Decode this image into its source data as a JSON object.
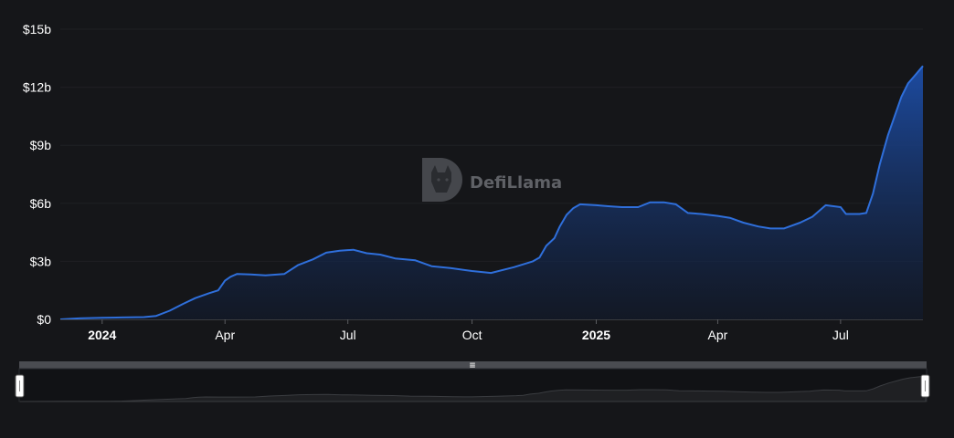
{
  "chart_data": {
    "type": "area",
    "title": "",
    "xlabel": "",
    "ylabel": "",
    "ylim": [
      0,
      15000000000
    ],
    "y_ticks": [
      {
        "value": 0,
        "label": "$0"
      },
      {
        "value": 3000000000,
        "label": "$3b"
      },
      {
        "value": 6000000000,
        "label": "$6b"
      },
      {
        "value": 9000000000,
        "label": "$9b"
      },
      {
        "value": 12000000000,
        "label": "$12b"
      },
      {
        "value": 15000000000,
        "label": "$15b"
      }
    ],
    "x_range": [
      "2023-12-01",
      "2025-08-31"
    ],
    "x_ticks": [
      {
        "date": "2024-01-01",
        "label": "2024",
        "strong": true
      },
      {
        "date": "2024-04-01",
        "label": "Apr",
        "strong": false
      },
      {
        "date": "2024-07-01",
        "label": "Jul",
        "strong": false
      },
      {
        "date": "2024-10-01",
        "label": "Oct",
        "strong": false
      },
      {
        "date": "2025-01-01",
        "label": "2025",
        "strong": true
      },
      {
        "date": "2025-04-01",
        "label": "Apr",
        "strong": false
      },
      {
        "date": "2025-07-01",
        "label": "Jul",
        "strong": false
      }
    ],
    "grid": true,
    "line_color": "#2f6fdb",
    "fill_color_top": "#1d4ea8",
    "fill_color_bottom": "#111a2d",
    "series": [
      {
        "x": [
          "2023-12-01",
          "2023-12-15",
          "2024-01-01",
          "2024-01-15",
          "2024-02-01",
          "2024-02-10",
          "2024-02-20",
          "2024-03-01",
          "2024-03-10",
          "2024-03-20",
          "2024-03-27",
          "2024-04-01",
          "2024-04-05",
          "2024-04-10",
          "2024-04-20",
          "2024-05-01",
          "2024-05-15",
          "2024-05-25",
          "2024-06-05",
          "2024-06-15",
          "2024-06-25",
          "2024-07-05",
          "2024-07-15",
          "2024-07-25",
          "2024-08-05",
          "2024-08-20",
          "2024-09-01",
          "2024-09-15",
          "2024-10-01",
          "2024-10-15",
          "2024-11-01",
          "2024-11-15",
          "2024-11-20",
          "2024-11-25",
          "2024-12-01",
          "2024-12-05",
          "2024-12-10",
          "2024-12-15",
          "2024-12-20",
          "2025-01-01",
          "2025-01-10",
          "2025-01-20",
          "2025-02-01",
          "2025-02-10",
          "2025-02-20",
          "2025-03-01",
          "2025-03-10",
          "2025-03-20",
          "2025-04-01",
          "2025-04-10",
          "2025-04-20",
          "2025-05-01",
          "2025-05-10",
          "2025-05-20",
          "2025-06-01",
          "2025-06-10",
          "2025-06-20",
          "2025-07-01",
          "2025-07-05",
          "2025-07-10",
          "2025-07-15",
          "2025-07-20",
          "2025-07-25",
          "2025-07-30",
          "2025-08-05",
          "2025-08-10",
          "2025-08-15",
          "2025-08-20",
          "2025-08-25",
          "2025-08-31"
        ],
        "values": [
          0.0,
          50000000.0,
          80000000.0,
          100000000.0,
          120000000.0,
          180000000.0,
          450000000.0,
          800000000.0,
          1100000000.0,
          1350000000.0,
          1500000000.0,
          2000000000.0,
          2200000000.0,
          2350000000.0,
          2320000000.0,
          2280000000.0,
          2350000000.0,
          2800000000.0,
          3100000000.0,
          3450000000.0,
          3550000000.0,
          3600000000.0,
          3420000000.0,
          3350000000.0,
          3150000000.0,
          3050000000.0,
          2750000000.0,
          2650000000.0,
          2500000000.0,
          2400000000.0,
          2700000000.0,
          3000000000.0,
          3200000000.0,
          3800000000.0,
          4200000000.0,
          4800000000.0,
          5400000000.0,
          5750000000.0,
          5950000000.0,
          5900000000.0,
          5850000000.0,
          5800000000.0,
          5800000000.0,
          6050000000.0,
          6050000000.0,
          5950000000.0,
          5500000000.0,
          5450000000.0,
          5350000000.0,
          5250000000.0,
          5000000000.0,
          4800000000.0,
          4700000000.0,
          4700000000.0,
          5000000000.0,
          5300000000.0,
          5900000000.0,
          5800000000.0,
          5450000000.0,
          5450000000.0,
          5450000000.0,
          5500000000.0,
          6500000000.0,
          8000000000.0,
          9500000000.0,
          10500000000.0,
          11500000000.0,
          12200000000.0,
          12600000000.0,
          13100000000.0
        ]
      }
    ]
  },
  "watermark": {
    "text": "DefiLlama"
  },
  "range_selector": {
    "handle_glyph": "≡"
  }
}
